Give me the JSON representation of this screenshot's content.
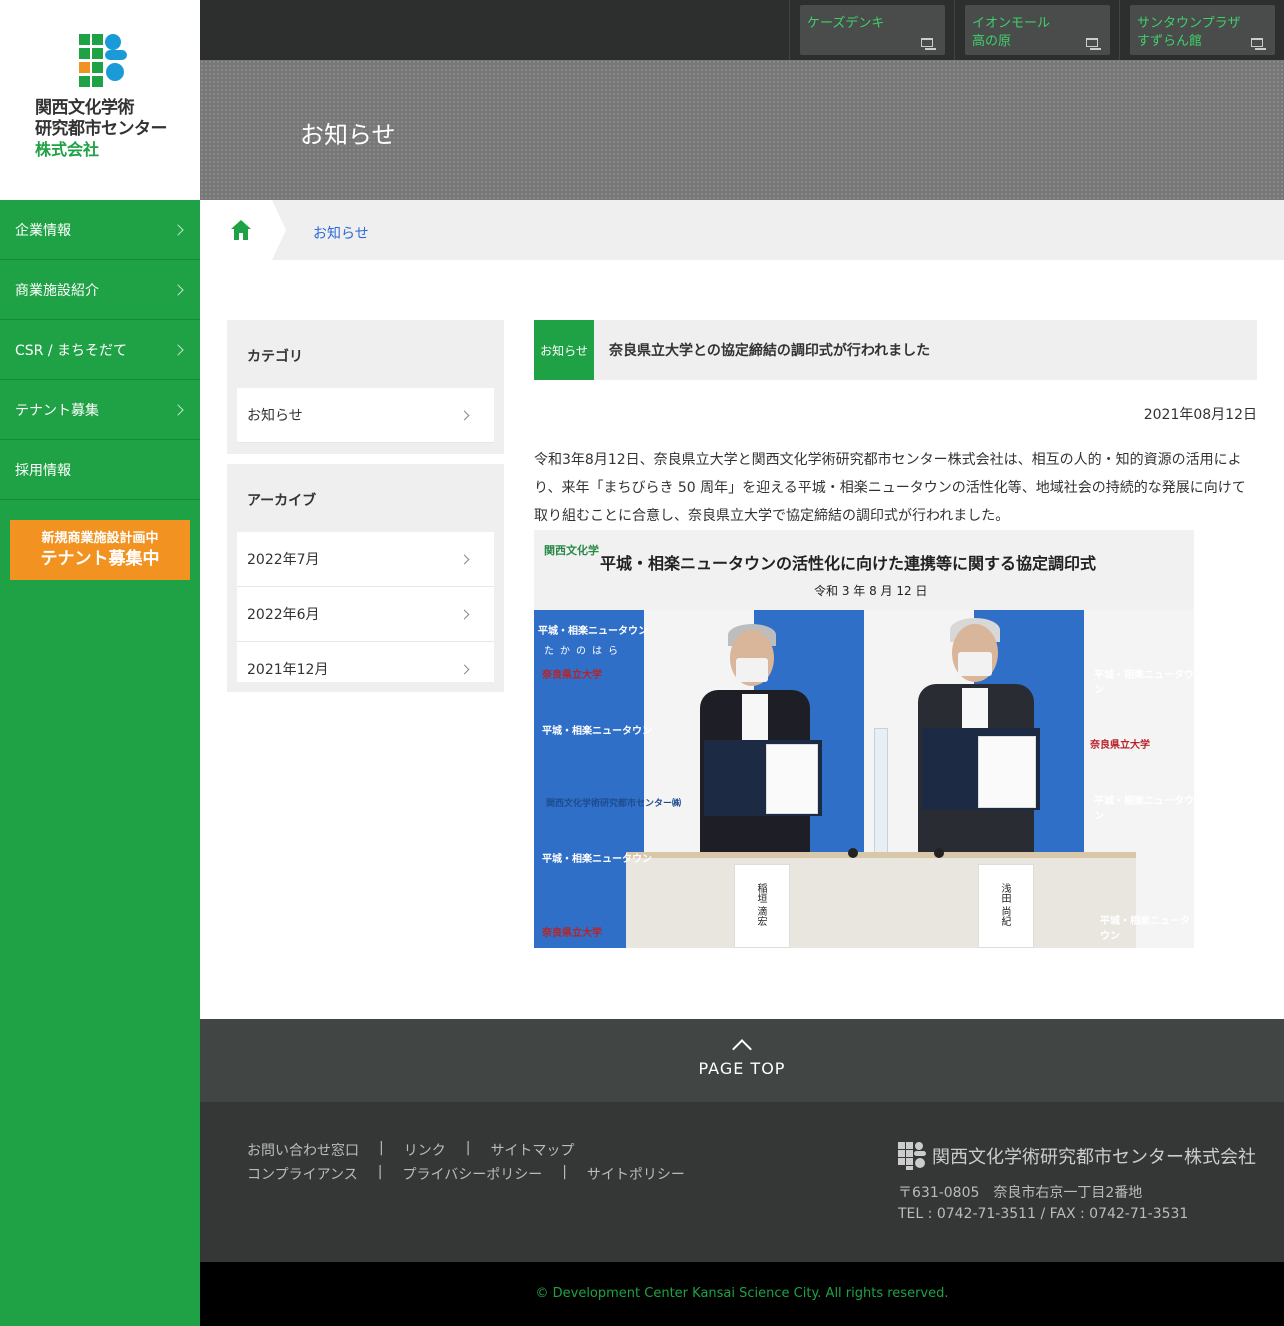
{
  "brand": {
    "logo_line1": "関西文化学術",
    "logo_line2": "研究都市センター",
    "logo_line3": "株式会社"
  },
  "sidebar": {
    "items": [
      {
        "label": "企業情報",
        "has_chevron": true
      },
      {
        "label": "商業施設紹介",
        "has_chevron": true
      },
      {
        "label": "CSR / まちそだて",
        "has_chevron": true
      },
      {
        "label": "テナント募集",
        "has_chevron": true
      },
      {
        "label": "採用情報",
        "has_chevron": false
      }
    ],
    "banner_line1": "新規商業施設計画中",
    "banner_line2": "テナント募集中"
  },
  "topbar": {
    "shops": [
      {
        "line1": "ケーズデンキ",
        "line2": ""
      },
      {
        "line1": "イオンモール",
        "line2": "高の原"
      },
      {
        "line1": "サンタウンプラザ",
        "line2": "すずらん館"
      }
    ]
  },
  "hero": {
    "title": "お知らせ"
  },
  "breadcrumb": {
    "current": "お知らせ"
  },
  "category_panel": {
    "title": "カテゴリ",
    "items": [
      "お知らせ"
    ]
  },
  "archive_panel": {
    "title": "アーカイブ",
    "items": [
      "2022年7月",
      "2022年6月",
      "2021年12月"
    ]
  },
  "article": {
    "category": "お知らせ",
    "title": "奈良県立大学との協定締結の調印式が行われました",
    "date": "2021年08月12日",
    "body": "令和3年8月12日、奈良県立大学と関西文化学術研究都市センター株式会社は、相互の人的・知的資源の活用により、来年「まちびらき 50 周年」を迎える平城・相楽ニュータウンの活性化等、地域社会の持続的な発展に向けて取り組むことに合意し、奈良県立大学で協定締結の調印式が行われました。",
    "photo": {
      "banner_logo": "関西文化学",
      "banner_title": "平城・相楽ニュータウンの活性化に向けた連携等に関する協定調印式",
      "banner_date": "令和 3 年 8 月 12 日",
      "backdrop_texts": [
        "平城・相楽ニュータウン",
        "たかのはら",
        "奈良県立大学",
        "関西文化学術研究都市センター㈱"
      ],
      "nameplate_left": "稲垣 滴宏",
      "nameplate_right": "浅田 尚紀"
    }
  },
  "pagetop": {
    "label": "PAGE TOP"
  },
  "footer": {
    "links_row1": [
      "お問い合わせ窓口",
      "リンク",
      "サイトマップ"
    ],
    "links_row2": [
      "コンプライアンス",
      "プライバシーポリシー",
      "サイトポリシー"
    ],
    "company": "関西文化学術研究都市センター株式会社",
    "address": "〒631-0805　奈良市右京一丁目2番地",
    "tel": "TEL : 0742-71-3511 / FAX : 0742-71-3531",
    "copyright": "© Development Center Kansai Science City. All rights reserved."
  },
  "colors": {
    "brand_green": "#1fa245",
    "banner_orange": "#f29221",
    "link_blue": "#2e6bd9"
  }
}
